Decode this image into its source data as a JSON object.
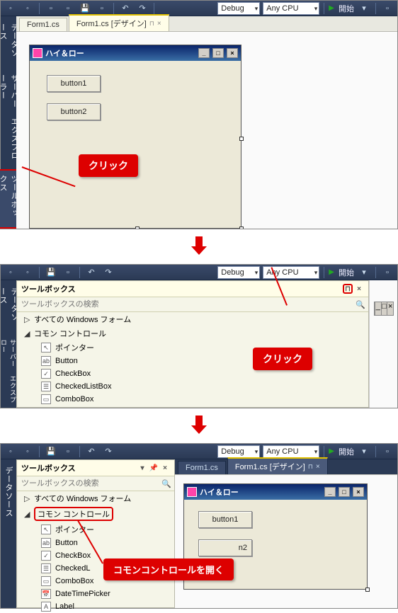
{
  "toolbar": {
    "config": "Debug",
    "platform": "Any CPU",
    "run_label": "開始"
  },
  "tabs": {
    "inactive": "Form1.cs",
    "active": "Form1.cs [デザイン]"
  },
  "side_tabs": {
    "datasource": "データソース",
    "server_explorer": "サーバー エクスプローラー",
    "toolbox": "ツールボックス"
  },
  "form": {
    "title": "ハイ＆ロー",
    "button1": "button1",
    "button2": "button2"
  },
  "callouts": {
    "click": "クリック",
    "open_common": "コモンコントロールを開く"
  },
  "toolbox": {
    "title": "ツールボックス",
    "search_placeholder": "ツールボックスの検索",
    "groups": {
      "all_windows_forms": "すべての Windows フォーム",
      "common_controls": "コモン コントロール"
    },
    "items": {
      "pointer": "ポインター",
      "button": "Button",
      "checkbox": "CheckBox",
      "checkedlistbox": "CheckedListBox",
      "combobox": "ComboBox",
      "datetimepicker": "DateTimePicker",
      "label": "Label"
    }
  }
}
